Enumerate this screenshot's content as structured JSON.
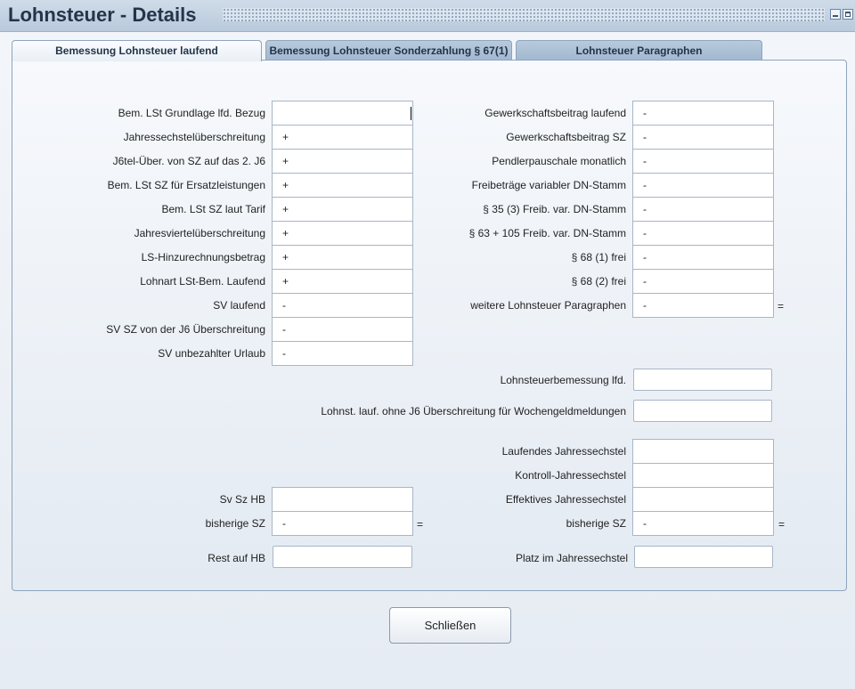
{
  "window": {
    "title": "Lohnsteuer - Details"
  },
  "tabs": [
    {
      "label": "Bemessung Lohnsteuer laufend",
      "active": true
    },
    {
      "label": "Bemessung Lohnsteuer Sonderzahlung § 67(1)",
      "active": false
    },
    {
      "label": "Lohnsteuer Paragraphen",
      "active": false
    }
  ],
  "left_rows": [
    {
      "label": "Bem. LSt Grundlage lfd. Bezug",
      "value": ""
    },
    {
      "label": "Jahressechstelüberschreitung",
      "value": "+"
    },
    {
      "label": "J6tel-Über. von SZ auf das 2. J6",
      "value": "+"
    },
    {
      "label": "Bem. LSt SZ  für Ersatzleistungen",
      "value": "+"
    },
    {
      "label": "Bem. LSt SZ laut Tarif",
      "value": "+"
    },
    {
      "label": "Jahresviertelüberschreitung",
      "value": "+"
    },
    {
      "label": "LS-Hinzurechnungsbetrag",
      "value": "+"
    },
    {
      "label": "Lohnart LSt-Bem. Laufend",
      "value": "+"
    },
    {
      "label": "SV laufend",
      "value": "-"
    },
    {
      "label": "SV SZ von der J6 Überschreitung",
      "value": "-"
    },
    {
      "label": "SV unbezahlter Urlaub",
      "value": "-"
    }
  ],
  "right_rows": [
    {
      "label": "Gewerkschaftsbeitrag laufend",
      "value": "-"
    },
    {
      "label": "Gewerkschaftsbeitrag SZ",
      "value": "-"
    },
    {
      "label": "Pendlerpauschale monatlich",
      "value": "-"
    },
    {
      "label": "Freibeträge variabler DN-Stamm",
      "value": "-"
    },
    {
      "label": "§ 35 (3) Freib. var. DN-Stamm",
      "value": "-"
    },
    {
      "label": "§ 63 + 105 Freib. var. DN-Stamm",
      "value": "-"
    },
    {
      "label": "§ 68 (1) frei",
      "value": "-"
    },
    {
      "label": "§ 68 (2) frei",
      "value": "-"
    },
    {
      "label": "weitere Lohnsteuer Paragraphen",
      "value": "-"
    }
  ],
  "right_total_eq": "=",
  "lohnsteuerbemessung": {
    "label": "Lohnsteuerbemessung lfd.",
    "value": ""
  },
  "ohne_j6": {
    "label": "Lohnst. lauf. ohne J6 Überschreitung für Wochengeldmeldungen",
    "value": ""
  },
  "jahressechstel": [
    {
      "label": "Laufendes Jahressechstel",
      "value": ""
    },
    {
      "label": "Kontroll-Jahressechstel",
      "value": ""
    },
    {
      "label": "Effektives Jahressechstel",
      "value": ""
    },
    {
      "label": "bisherige SZ",
      "value": "-"
    }
  ],
  "jahressechstel_eq": "=",
  "platz": {
    "label": "Platz im Jahressechstel",
    "value": ""
  },
  "sv_sz_hb": [
    {
      "label": "Sv Sz HB",
      "value": ""
    },
    {
      "label": "bisherige SZ",
      "value": "-"
    }
  ],
  "sv_sz_hb_eq": "=",
  "rest_auf_hb": {
    "label": "Rest auf HB",
    "value": ""
  },
  "close_button": "Schließen"
}
